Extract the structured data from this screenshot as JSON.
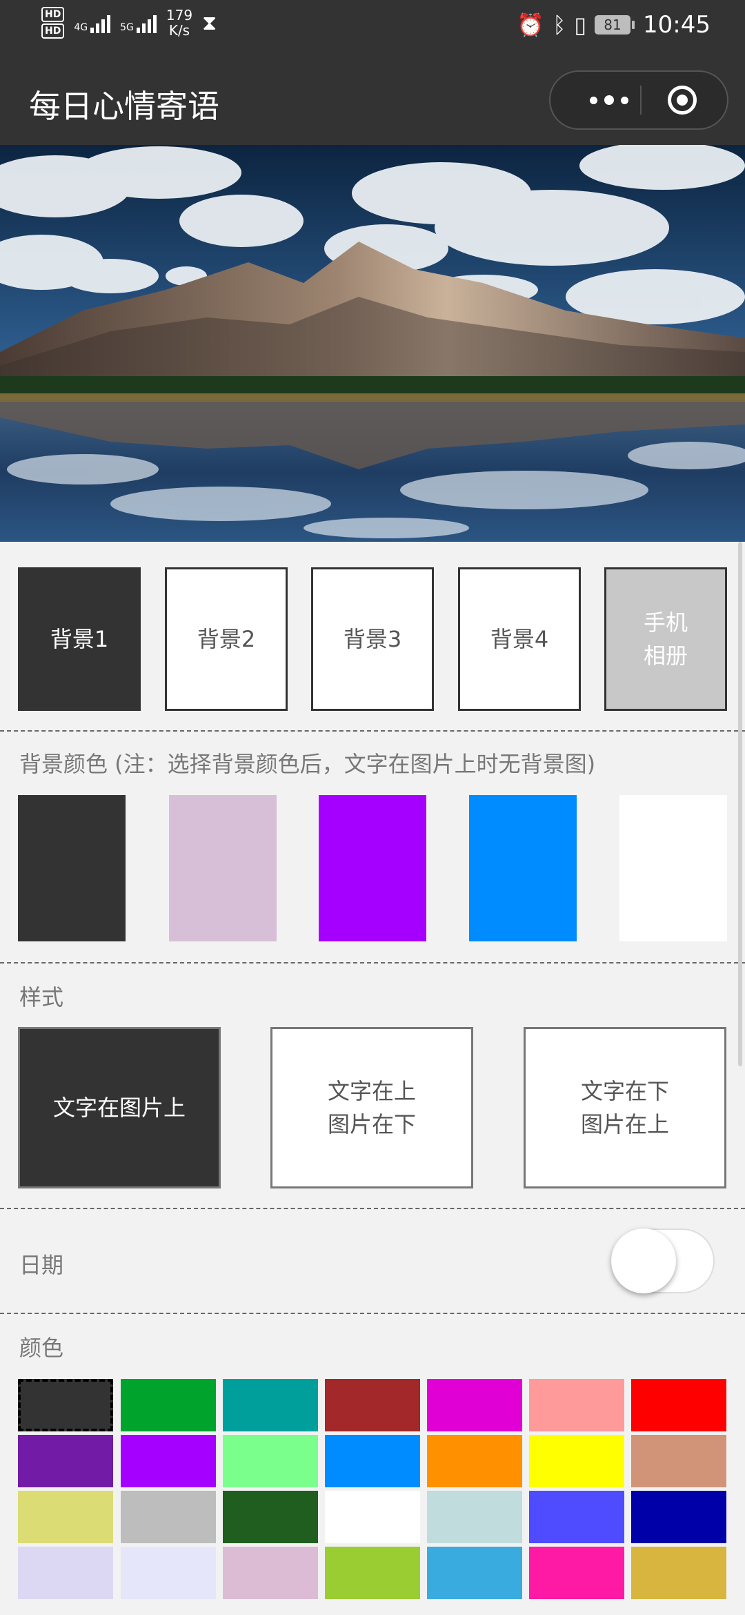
{
  "status_bar": {
    "hd1": "HD",
    "hd2": "HD",
    "net1": "4G",
    "net2": "5G",
    "speed_value": "179",
    "speed_unit": "K/s",
    "battery": "81",
    "time": "10:45"
  },
  "nav": {
    "title": "每日心情寄语"
  },
  "backgrounds": {
    "items": [
      "背景1",
      "背景2",
      "背景3",
      "背景4"
    ],
    "album_line1": "手机",
    "album_line2": "相册",
    "selected_index": 0
  },
  "bg_color": {
    "label": "背景颜色 (注：选择背景颜色后，文字在图片上时无背景图)",
    "colors": [
      "#333333",
      "#d8bfd8",
      "#a500ff",
      "#008cff",
      "#ffffff"
    ]
  },
  "style": {
    "label": "样式",
    "option1": "文字在图片上",
    "option2_line1": "文字在上",
    "option2_line2": "图片在下",
    "option3_line1": "文字在下",
    "option3_line2": "图片在上"
  },
  "date": {
    "label": "日期",
    "enabled": false
  },
  "text_color": {
    "label": "颜色",
    "colors": [
      "#333333",
      "#00a42c",
      "#009f9c",
      "#a2282a",
      "#e000d6",
      "#ff9a9a",
      "#ff0000",
      "#721ba6",
      "#a500ff",
      "#7bff8c",
      "#008cff",
      "#ff9000",
      "#ffff00",
      "#d19478",
      "#dcdc74",
      "#bdbdbd",
      "#205e20",
      "#ffffff",
      "#c0dcdc",
      "#4f4cff",
      "#0000a8",
      "#dcd8f4",
      "#e6e6fa",
      "#dcbcd4",
      "#9acd32",
      "#3aabdf",
      "#ff1aa6",
      "#d7b53e"
    ],
    "selected_index": 0
  }
}
